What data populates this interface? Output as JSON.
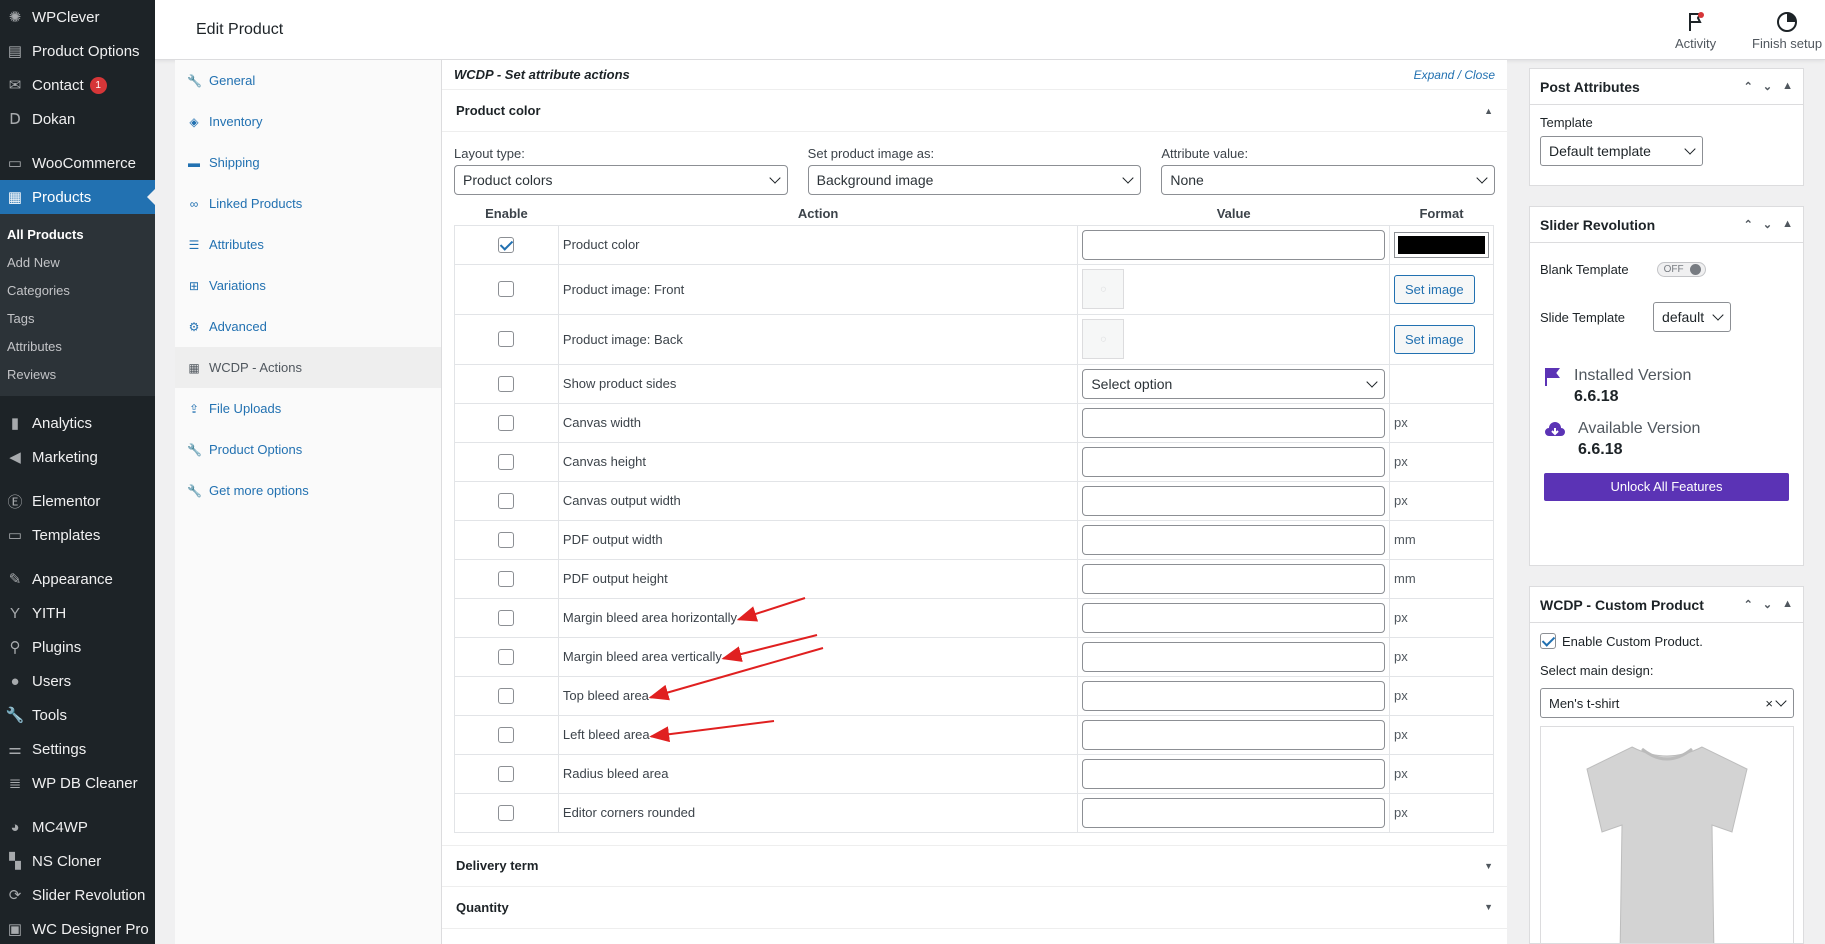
{
  "sidebar": {
    "items_top": [
      {
        "label": "WPClever",
        "icon": "clever-icon"
      },
      {
        "label": "Product Options",
        "icon": "options-icon"
      },
      {
        "label": "Contact",
        "icon": "mail-icon",
        "badge": "1"
      },
      {
        "label": "Dokan",
        "icon": "dokan-icon"
      }
    ],
    "woocommerce": {
      "label": "WooCommerce",
      "icon": "woo-icon"
    },
    "products": {
      "label": "Products",
      "icon": "archive-icon"
    },
    "products_sub": [
      "All Products",
      "Add New",
      "Categories",
      "Tags",
      "Attributes",
      "Reviews"
    ],
    "items_mid": [
      {
        "label": "Analytics",
        "icon": "chart-icon"
      },
      {
        "label": "Marketing",
        "icon": "megaphone-icon"
      }
    ],
    "items_mid2": [
      {
        "label": "Elementor",
        "icon": "elementor-icon"
      },
      {
        "label": "Templates",
        "icon": "folder-icon"
      }
    ],
    "items_mid3": [
      {
        "label": "Appearance",
        "icon": "brush-icon"
      },
      {
        "label": "YITH",
        "icon": "yith-icon"
      },
      {
        "label": "Plugins",
        "icon": "plugin-icon"
      },
      {
        "label": "Users",
        "icon": "user-icon"
      },
      {
        "label": "Tools",
        "icon": "wrench-icon"
      },
      {
        "label": "Settings",
        "icon": "settings-icon"
      },
      {
        "label": "WP DB Cleaner",
        "icon": "database-icon"
      }
    ],
    "items_bottom": [
      {
        "label": "MC4WP",
        "icon": "mc-icon"
      },
      {
        "label": "NS Cloner",
        "icon": "cloner-icon"
      },
      {
        "label": "Slider Revolution",
        "icon": "slider-icon"
      },
      {
        "label": "WC Designer Pro",
        "icon": "designer-icon"
      }
    ]
  },
  "header": {
    "title": "Edit Product",
    "activity": "Activity",
    "finish_setup": "Finish setup"
  },
  "tabs": [
    {
      "label": "General",
      "icon": "wrench-icon"
    },
    {
      "label": "Inventory",
      "icon": "tag-icon"
    },
    {
      "label": "Shipping",
      "icon": "truck-icon"
    },
    {
      "label": "Linked Products",
      "icon": "link-icon"
    },
    {
      "label": "Attributes",
      "icon": "list-icon"
    },
    {
      "label": "Variations",
      "icon": "grid-icon"
    },
    {
      "label": "Advanced",
      "icon": "gear-icon"
    },
    {
      "label": "WCDP - Actions",
      "icon": "grid-dots-icon",
      "current": true
    },
    {
      "label": "File Uploads",
      "icon": "upload-icon"
    },
    {
      "label": "Product Options",
      "icon": "wrench-icon"
    },
    {
      "label": "Get more options",
      "icon": "wrench-icon"
    }
  ],
  "main": {
    "section_title": "WCDP - Set attribute actions",
    "expand": "Expand",
    "slash": " / ",
    "close": "Close",
    "panel_title": "Product color",
    "layout_label": "Layout type:",
    "layout_value": "Product colors",
    "image_label": "Set product image as:",
    "image_value": "Background image",
    "attr_label": "Attribute value:",
    "attr_value": "None",
    "col_enable": "Enable",
    "col_action": "Action",
    "col_value": "Value",
    "col_format": "Format",
    "rows": [
      {
        "action": "Product color",
        "checked": true,
        "value_type": "input",
        "format": "swatch",
        "swatch_color": "#000000"
      },
      {
        "action": "Product image: Front",
        "checked": false,
        "value_type": "image",
        "format": "Set image"
      },
      {
        "action": "Product image: Back",
        "checked": false,
        "value_type": "image",
        "format": "Set image"
      },
      {
        "action": "Show product sides",
        "checked": false,
        "value_type": "select",
        "select_value": "Select option",
        "format": ""
      },
      {
        "action": "Canvas width",
        "checked": false,
        "value_type": "input",
        "format": "px"
      },
      {
        "action": "Canvas height",
        "checked": false,
        "value_type": "input",
        "format": "px"
      },
      {
        "action": "Canvas output width",
        "checked": false,
        "value_type": "input",
        "format": "px"
      },
      {
        "action": "PDF output width",
        "checked": false,
        "value_type": "input",
        "format": "mm"
      },
      {
        "action": "PDF output height",
        "checked": false,
        "value_type": "input",
        "format": "mm"
      },
      {
        "action": "Margin bleed area horizontally",
        "checked": false,
        "value_type": "input",
        "format": "px"
      },
      {
        "action": "Margin bleed area vertically",
        "checked": false,
        "value_type": "input",
        "format": "px"
      },
      {
        "action": "Top bleed area",
        "checked": false,
        "value_type": "input",
        "format": "px"
      },
      {
        "action": "Left bleed area",
        "checked": false,
        "value_type": "input",
        "format": "px"
      },
      {
        "action": "Radius bleed area",
        "checked": false,
        "value_type": "input",
        "format": "px"
      },
      {
        "action": "Editor corners rounded",
        "checked": false,
        "value_type": "input",
        "format": "px"
      }
    ],
    "delivery": "Delivery term",
    "quantity": "Quantity",
    "annotation_color": "#e02020"
  },
  "right": {
    "post_attr": {
      "title": "Post Attributes",
      "template_label": "Template",
      "template_value": "Default template"
    },
    "slider_rev": {
      "title": "Slider Revolution",
      "blank_label": "Blank Template",
      "toggle": "OFF",
      "slide_label": "Slide Template",
      "slide_value": "default",
      "installed_label": "Installed Version",
      "installed_value": "6.6.18",
      "available_label": "Available Version",
      "available_value": "6.6.18",
      "unlock": "Unlock All Features"
    },
    "wcdp": {
      "title": "WCDP - Custom Product",
      "enable": "Enable Custom Product.",
      "design_label": "Select main design:",
      "design_value": "Men's t-shirt",
      "clear": "×"
    }
  }
}
